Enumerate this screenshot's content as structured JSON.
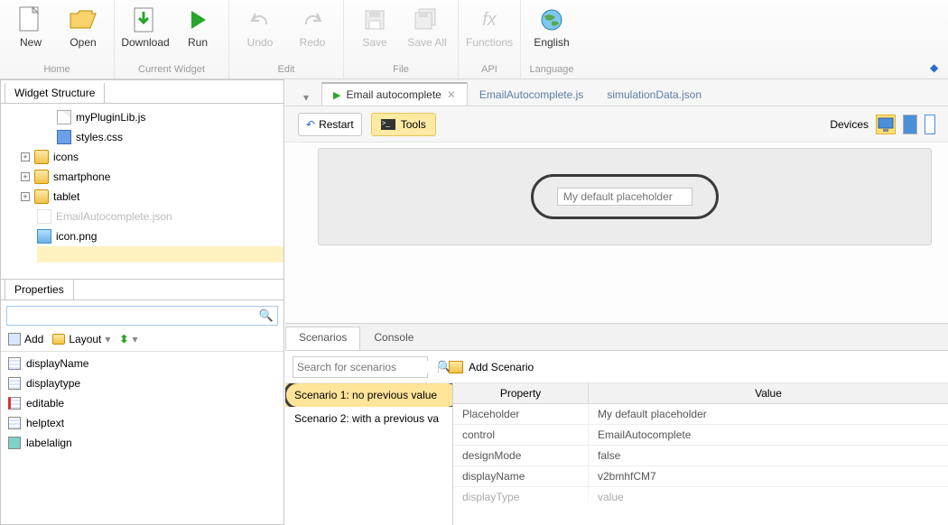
{
  "ribbon": {
    "groups": [
      {
        "caption": "Home",
        "buttons": [
          {
            "name": "new-button",
            "label": "New",
            "icon": "file"
          },
          {
            "name": "open-button",
            "label": "Open",
            "icon": "folder"
          }
        ]
      },
      {
        "caption": "Current Widget",
        "buttons": [
          {
            "name": "download-button",
            "label": "Download",
            "icon": "download"
          },
          {
            "name": "run-button",
            "label": "Run",
            "icon": "play"
          }
        ]
      },
      {
        "caption": "Edit",
        "buttons": [
          {
            "name": "undo-button",
            "label": "Undo",
            "icon": "undo",
            "disabled": true
          },
          {
            "name": "redo-button",
            "label": "Redo",
            "icon": "redo",
            "disabled": true
          }
        ]
      },
      {
        "caption": "File",
        "buttons": [
          {
            "name": "save-button",
            "label": "Save",
            "icon": "save",
            "disabled": true
          },
          {
            "name": "save-all-button",
            "label": "Save All",
            "icon": "saveall",
            "disabled": true
          }
        ]
      },
      {
        "caption": "API",
        "buttons": [
          {
            "name": "functions-button",
            "label": "Functions",
            "icon": "fx",
            "disabled": true
          }
        ]
      },
      {
        "caption": "Language",
        "buttons": [
          {
            "name": "language-button",
            "label": "English",
            "icon": "globe"
          }
        ]
      }
    ]
  },
  "widgetStructure": {
    "title": "Widget Structure",
    "items": [
      {
        "name": "file-mypluginlib",
        "type": "file",
        "label": "myPluginLib.js"
      },
      {
        "name": "file-styles",
        "type": "css",
        "label": "styles.css"
      },
      {
        "name": "folder-icons",
        "type": "folder",
        "label": "icons",
        "expandable": true
      },
      {
        "name": "folder-smartphone",
        "type": "folder",
        "label": "smartphone",
        "expandable": true
      },
      {
        "name": "folder-tablet",
        "type": "folder",
        "label": "tablet",
        "expandable": true
      },
      {
        "name": "file-emailautocomplete-json",
        "type": "json-dim",
        "label": "EmailAutocomplete.json",
        "muted": true
      },
      {
        "name": "file-icon-png",
        "type": "img",
        "label": "icon.png"
      }
    ]
  },
  "properties": {
    "title": "Properties",
    "toolbar": {
      "add": "Add",
      "layout": "Layout"
    },
    "items": [
      {
        "name": "prop-displayname",
        "label": "displayName"
      },
      {
        "name": "prop-displaytype",
        "label": "displaytype"
      },
      {
        "name": "prop-editable",
        "label": "editable",
        "red": true
      },
      {
        "name": "prop-helptext",
        "label": "helptext"
      },
      {
        "name": "prop-labelalign",
        "label": "labelalign",
        "teal": true
      }
    ]
  },
  "editorTabs": [
    {
      "name": "tab-email-autocomplete",
      "label": "Email autocomplete",
      "active": true,
      "closable": true,
      "play": true
    },
    {
      "name": "tab-emailautocomplete-js",
      "label": "EmailAutocomplete.js"
    },
    {
      "name": "tab-simulationdata-json",
      "label": "simulationData.json"
    }
  ],
  "simBar": {
    "restart": "Restart",
    "tools": "Tools",
    "devicesLabel": "Devices"
  },
  "preview": {
    "placeholder": "My default placeholder"
  },
  "bottom": {
    "tabs": [
      {
        "name": "bottom-tab-scenarios",
        "label": "Scenarios",
        "active": true
      },
      {
        "name": "bottom-tab-console",
        "label": "Console"
      }
    ],
    "searchPlaceholder": "Search for scenarios",
    "addScenario": "Add Scenario",
    "scenarios": [
      {
        "name": "scenario-1",
        "label": "Scenario 1: no previous value",
        "active": true,
        "highlight": true
      },
      {
        "name": "scenario-2",
        "label": "Scenario 2: with a previous va"
      }
    ],
    "grid": {
      "headers": {
        "prop": "Property",
        "val": "Value"
      },
      "rows": [
        {
          "prop": "Placeholder",
          "val": "My default placeholder"
        },
        {
          "prop": "control",
          "val": "EmailAutocomplete"
        },
        {
          "prop": "designMode",
          "val": "false"
        },
        {
          "prop": "displayName",
          "val": "v2bmhfCM7"
        },
        {
          "prop": "displayType",
          "val": "value"
        }
      ]
    }
  }
}
